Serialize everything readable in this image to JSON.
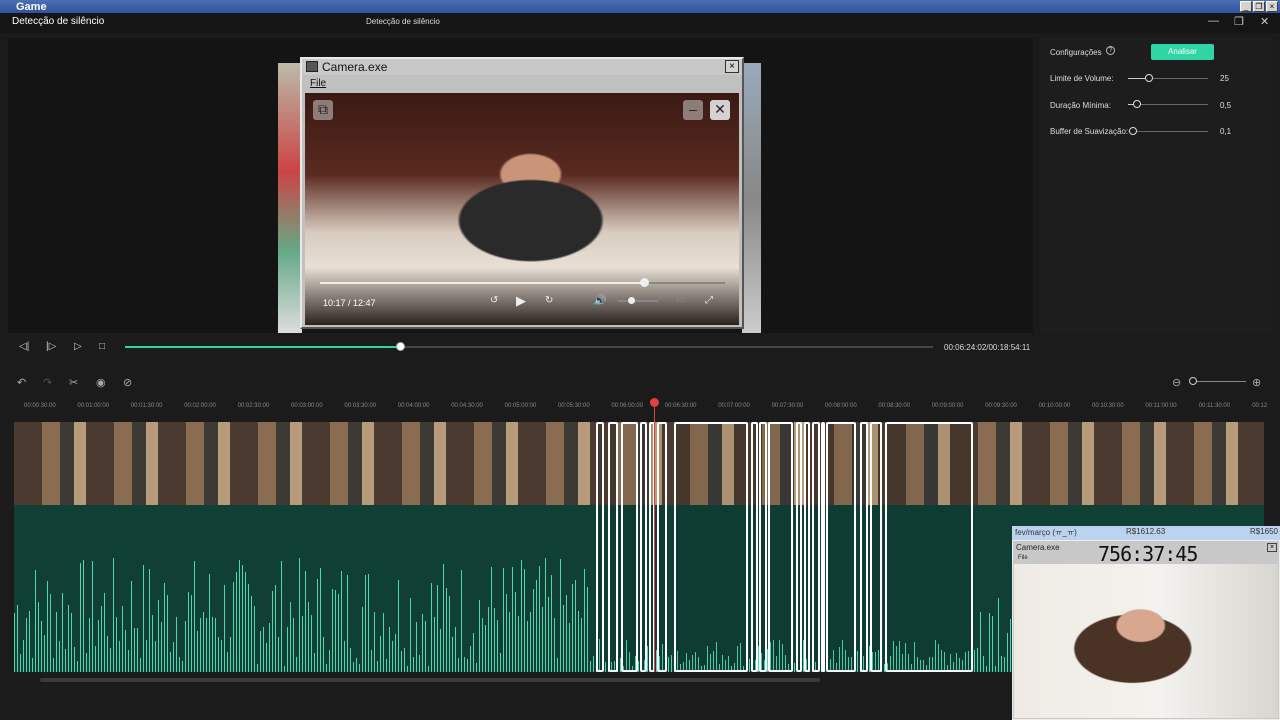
{
  "game_title": "Game",
  "app": {
    "window_title": "Detecção de silêncio",
    "center_title": "Detecção de silêncio"
  },
  "settings": {
    "label": "Configurações",
    "analyze_button": "Analisar",
    "volume_label": "Limite de Volume:",
    "volume_value": "25",
    "duration_label": "Duração Mínima:",
    "duration_value": "0,5",
    "buffer_label": "Buffer de Suavização:",
    "buffer_value": "0,1"
  },
  "playback": {
    "time": "00:06:24:02/00:18:54:11",
    "progress": 0.34
  },
  "ruler_ticks": [
    "00:00:30:00",
    "00:01:00:00",
    "00:01:30:00",
    "00:02:00:00",
    "00:02:30:00",
    "00:03:00:00",
    "00:03:30:00",
    "00:04:00:00",
    "00:04:30:00",
    "00:05:00:00",
    "00:05:30:00",
    "00:06:00:00",
    "00:06:30:00",
    "00:07:00:00",
    "00:07:30:00",
    "00:08:00:00",
    "00:08:30:00",
    "00:09:00:00",
    "00:09:30:00",
    "00:10:00:00",
    "00:10:30:00",
    "00:11:00:00",
    "00:11:30:00",
    "00:12"
  ],
  "camera": {
    "title": "Camera.exe",
    "menu_file": "File",
    "time": "10:17 / 12:47",
    "seek_progress": 0.8
  },
  "small_camera": {
    "label": "fev/março (ㅠ_ㅠ)",
    "amount1": "R$1612.63",
    "amount2": "R$1650",
    "title": "Camera.exe",
    "menu": "File",
    "timer": "756:37:45"
  },
  "colors": {
    "accent": "#2fd5a5",
    "playhead": "#e04040",
    "audio_bg": "#0f3f35"
  }
}
